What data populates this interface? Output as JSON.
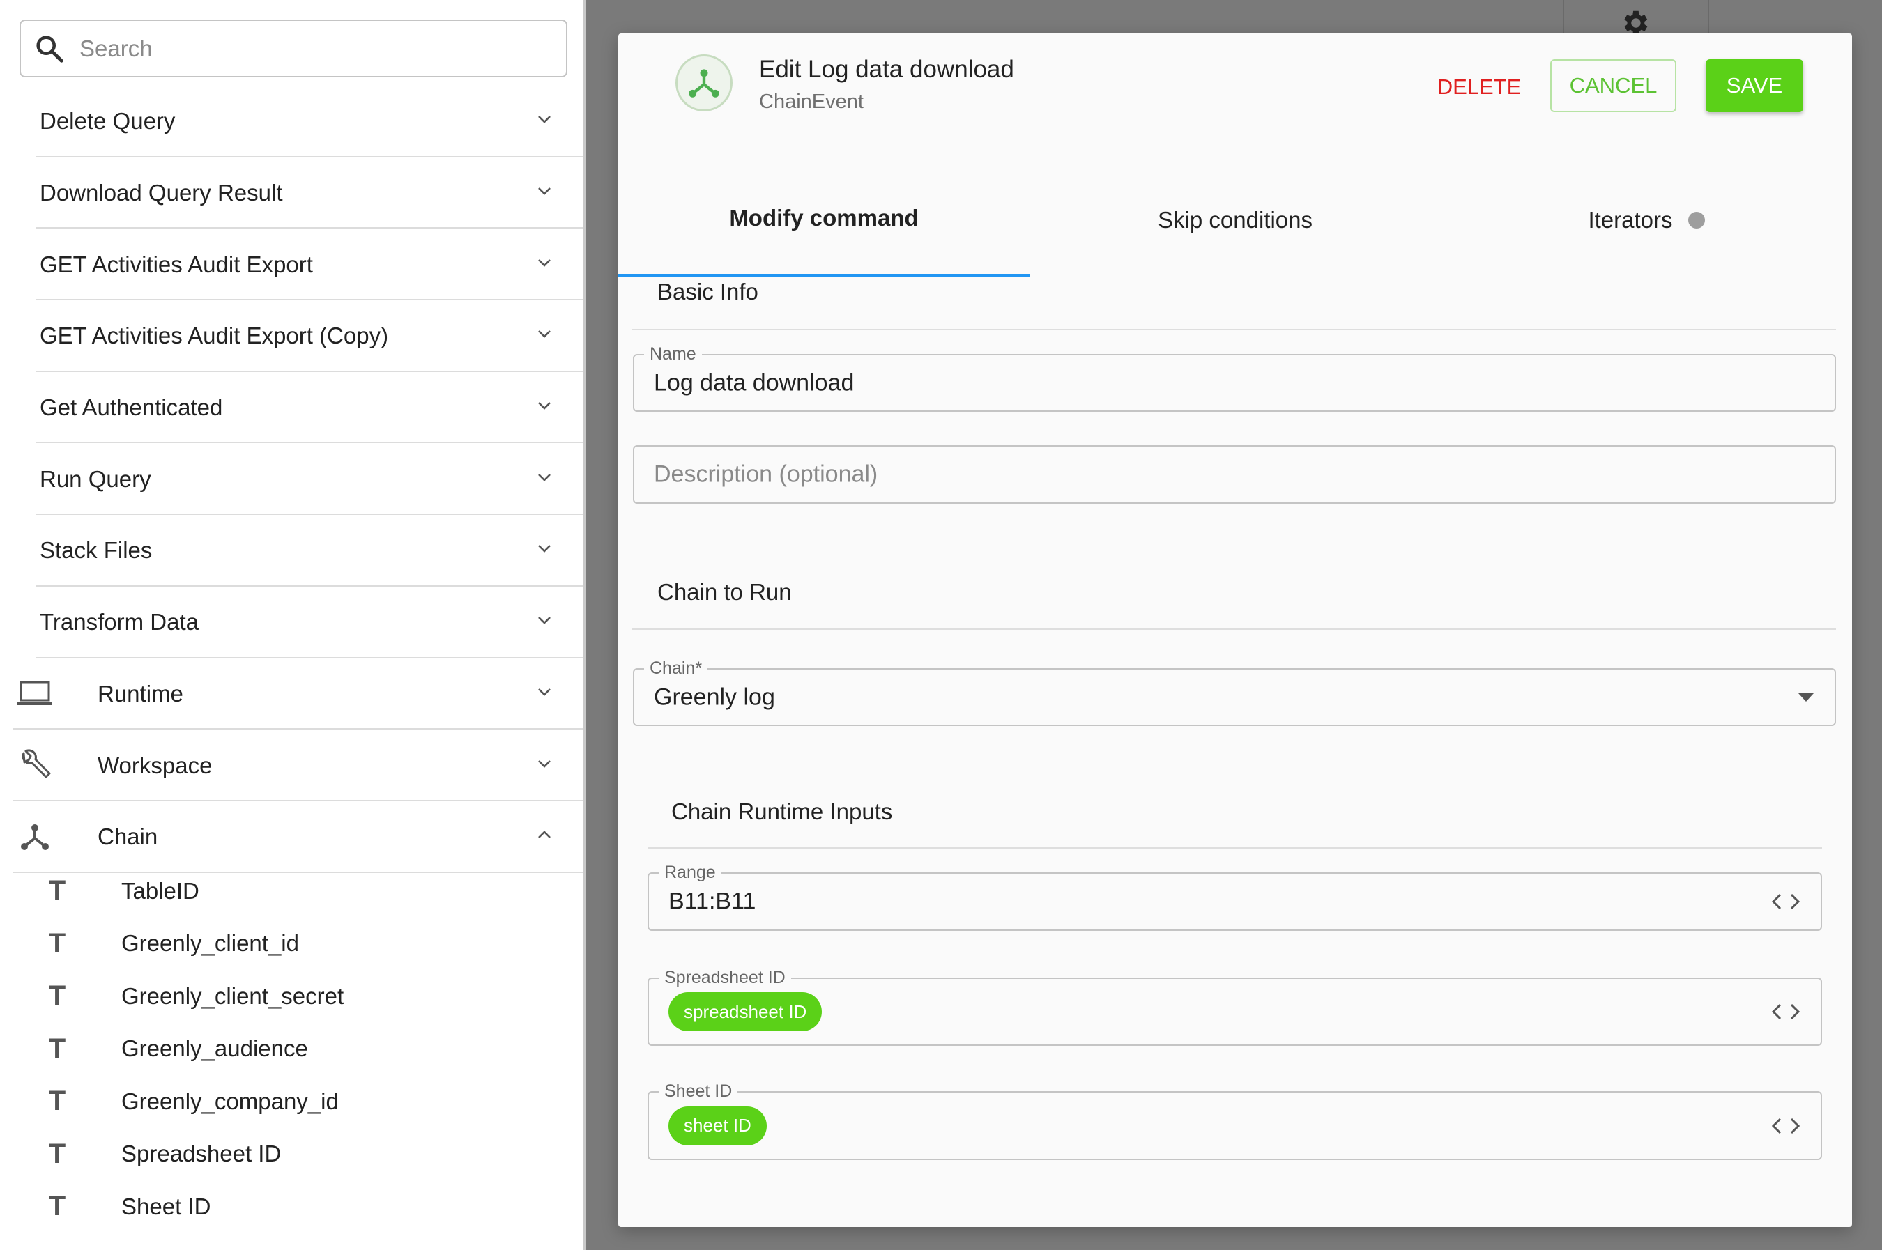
{
  "search": {
    "placeholder": "Search"
  },
  "sidebar": {
    "commands": [
      {
        "label": "Delete Query"
      },
      {
        "label": "Download Query Result"
      },
      {
        "label": "GET Activities Audit Export"
      },
      {
        "label": "GET Activities Audit Export (Copy)"
      },
      {
        "label": "Get Authenticated"
      },
      {
        "label": "Run Query"
      },
      {
        "label": "Stack Files"
      },
      {
        "label": "Transform Data"
      }
    ],
    "groups": [
      {
        "label": "Runtime",
        "icon": "laptop-icon",
        "expanded": false
      },
      {
        "label": "Workspace",
        "icon": "wrench-icon",
        "expanded": false
      },
      {
        "label": "Chain",
        "icon": "chain-icon",
        "expanded": true
      }
    ],
    "chain_variables": [
      {
        "type_icon": "T",
        "label": "TableID"
      },
      {
        "type_icon": "T",
        "label": "Greenly_client_id"
      },
      {
        "type_icon": "T",
        "label": "Greenly_client_secret"
      },
      {
        "type_icon": "T",
        "label": "Greenly_audience"
      },
      {
        "type_icon": "T",
        "label": "Greenly_company_id"
      },
      {
        "type_icon": "T",
        "label": "Spreadsheet ID"
      },
      {
        "type_icon": "T",
        "label": "Sheet ID"
      }
    ]
  },
  "modal": {
    "title": "Edit Log data download",
    "subtitle": "ChainEvent",
    "icon": "chain-icon",
    "delete_label": "DELETE",
    "cancel_label": "CANCEL",
    "save_label": "SAVE",
    "tabs": [
      {
        "label": "Modify command",
        "active": true
      },
      {
        "label": "Skip conditions",
        "active": false
      },
      {
        "label": "Iterators",
        "active": false,
        "indicator": "status-dot"
      }
    ],
    "basic_info": {
      "title": "Basic Info",
      "name_label": "Name",
      "name_value": "Log data download",
      "description_placeholder": "Description (optional)"
    },
    "chain_to_run": {
      "title": "Chain to Run",
      "chain_label": "Chain*",
      "chain_value": "Greenly log"
    },
    "runtime_inputs": {
      "title": "Chain Runtime Inputs",
      "range_label": "Range",
      "range_value": "B11:B11",
      "spreadsheet_label": "Spreadsheet ID",
      "spreadsheet_chip": "spreadsheet ID",
      "sheet_label": "Sheet ID",
      "sheet_chip": "sheet ID"
    }
  },
  "colors": {
    "accent_green": "#5bd118",
    "delete_red": "#e02020",
    "tab_indicator_blue": "#2196f3"
  }
}
